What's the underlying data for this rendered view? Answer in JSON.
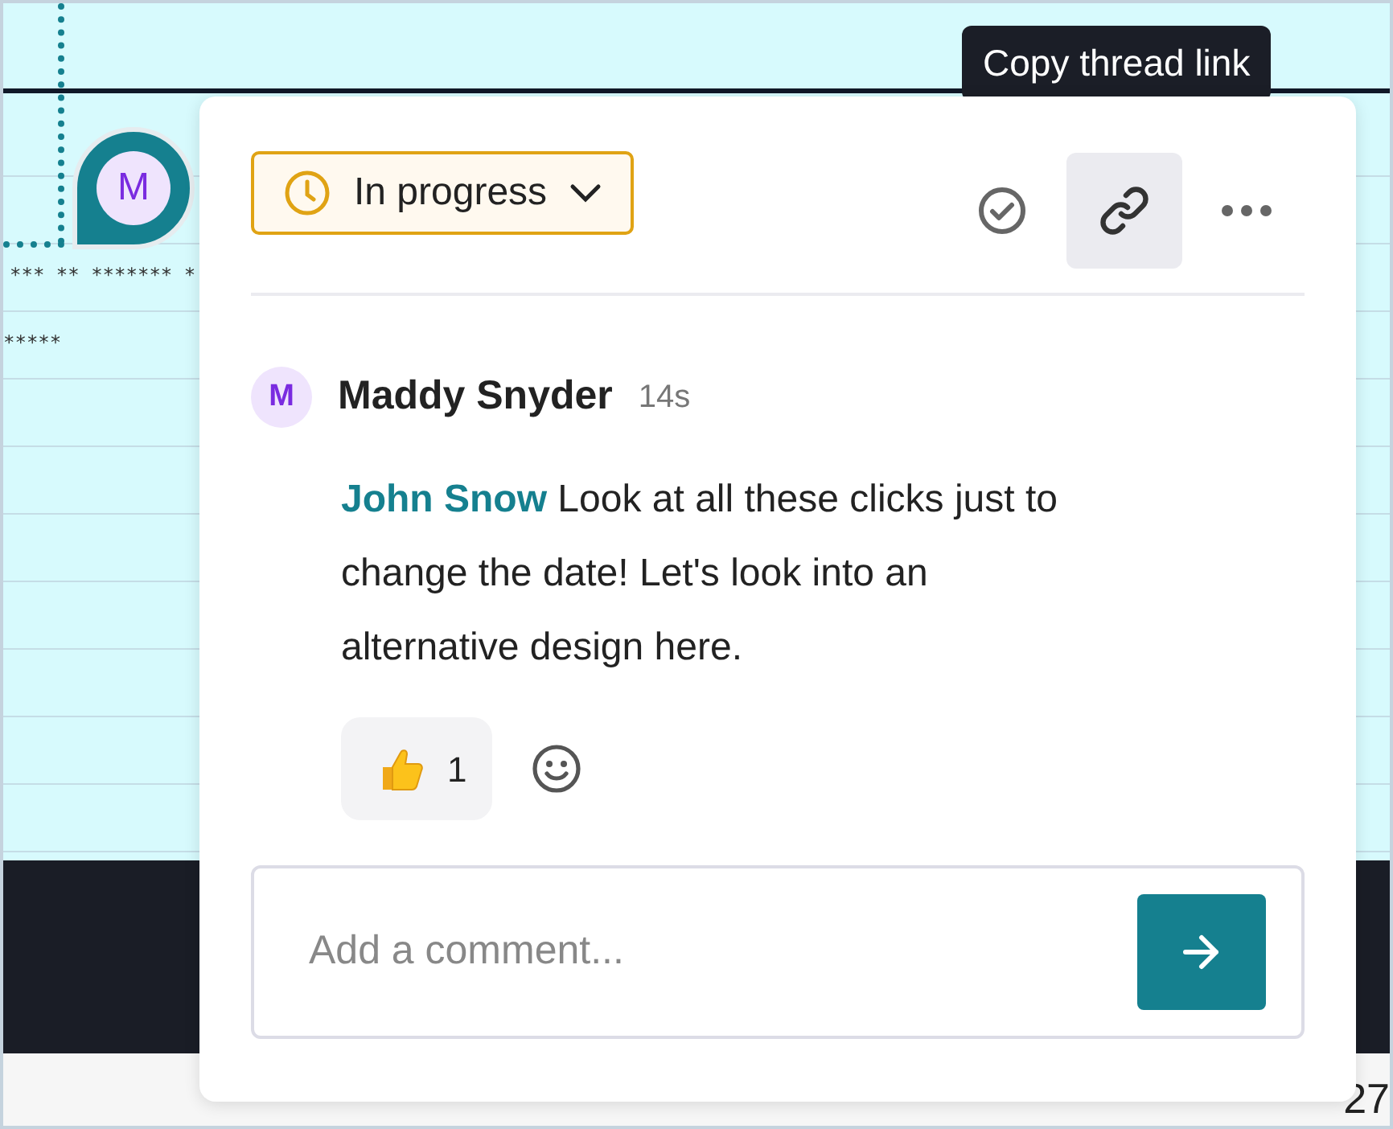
{
  "background": {
    "marker": {
      "initial": "M"
    },
    "row_texts": [
      "*** ** ******* *",
      "*****"
    ],
    "date": "27"
  },
  "tooltip": {
    "text": "Copy thread link"
  },
  "popover": {
    "status": {
      "label": "In progress"
    },
    "actions": [
      {
        "kind": "resolve",
        "highlighted": false
      },
      {
        "kind": "link",
        "highlighted": true
      },
      {
        "kind": "more",
        "highlighted": false
      }
    ],
    "comment": {
      "initial": "M",
      "author": "Maddy Snyder",
      "time": "14s",
      "mention": "John Snow",
      "text": "Look at all these clicks just to change the date! Let's look into an alternative design here."
    },
    "reactions": [
      {
        "kind": "thumbs-up",
        "count": "1"
      }
    ],
    "input": {
      "placeholder": "Add a comment..."
    }
  }
}
